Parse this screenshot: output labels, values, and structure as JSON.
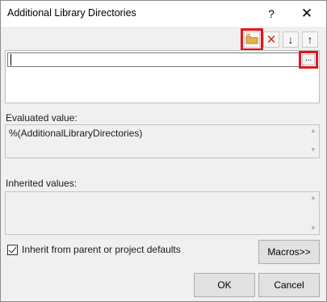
{
  "window": {
    "title": "Additional Library Directories",
    "help_glyph": "?",
    "close_glyph": "✕"
  },
  "toolbar": {
    "new_folder_icon": "new-folder-icon",
    "delete_glyph": "✕",
    "down_glyph": "↓",
    "up_glyph": "↑"
  },
  "list": {
    "edit_value": "",
    "browse_label": "..."
  },
  "evaluated": {
    "label": "Evaluated value:",
    "value": "%(AdditionalLibraryDirectories)"
  },
  "inherited": {
    "label": "Inherited values:",
    "value": ""
  },
  "inherit_checkbox": {
    "label": "Inherit from parent or project defaults",
    "checked": true
  },
  "buttons": {
    "macros": "Macros>>",
    "ok": "OK",
    "cancel": "Cancel"
  },
  "colors": {
    "highlight": "#e0161f",
    "delete_icon": "#c42b1c",
    "folder": "#e3b24b"
  }
}
